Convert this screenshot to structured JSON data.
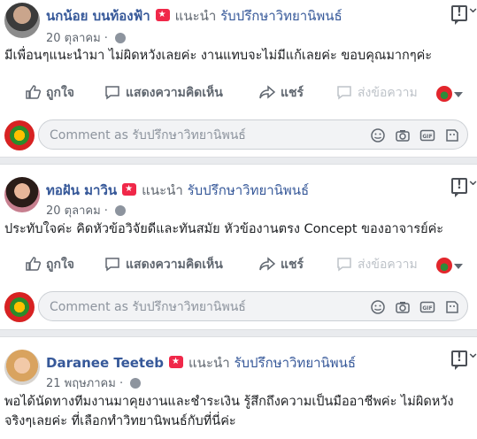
{
  "reviews": [
    {
      "name": "นกน้อย บนท้องฟ้า",
      "recommends": "แนะนำ",
      "page": "รับปรึกษาวิทยานิพนธ์",
      "date": "20 ตุลาคม",
      "text": "มีเพื่อนๆแนะนำมา ไม่ผิดหวังเลยค่ะ งานแทบจะไม่มีแก้เลยค่ะ ขอบคุณมากๆค่ะ"
    },
    {
      "name": "ทอฝัน มาวิน",
      "recommends": "แนะนำ",
      "page": "รับปรึกษาวิทยานิพนธ์",
      "date": "20 ตุลาคม",
      "text": "ประทับใจค่ะ คิดหัวข้อวิจัยดีและทันสมัย หัวข้องานตรง Concept ของอาจารย์ค่ะ"
    },
    {
      "name": "Daranee Teeteb",
      "recommends": "แนะนำ",
      "page": "รับปรึกษาวิทยานิพนธ์",
      "date": "21 พฤษภาคม",
      "text": "พอได้นัดทางทีมงานมาคุยงานและชำระเงิน รู้สึกถึงความเป็นมืออาชีพค่ะ ไม่ผิดหวังจริงๆเลยค่ะ ที่เลือกทำวิทยานิพนธ์กับที่นี่ค่ะ"
    }
  ],
  "actions": {
    "like": "ถูกใจ",
    "comment": "แสดงความคิดเห็น",
    "share": "แชร์",
    "message": "ส่งข้อความ"
  },
  "comment_box": {
    "placeholder": "Comment as รับปรึกษาวิทยานิพนธ์"
  },
  "icons": [
    "report-icon",
    "globe-icon",
    "like-icon",
    "comment-icon",
    "share-icon",
    "messenger-icon",
    "emoji-icon",
    "camera-icon",
    "gif-icon",
    "sticker-icon"
  ]
}
